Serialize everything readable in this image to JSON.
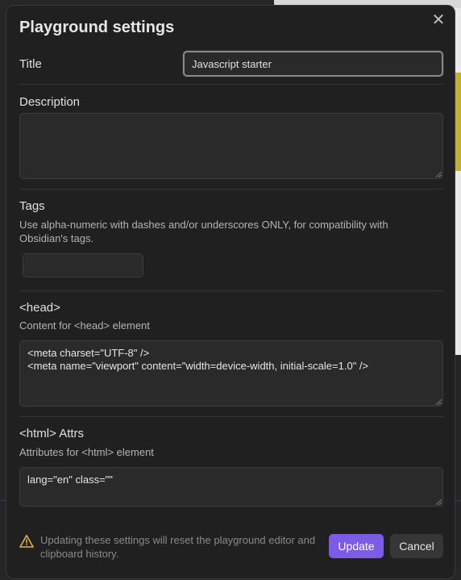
{
  "modal": {
    "title": "Playground settings",
    "close_glyph": "✕"
  },
  "fields": {
    "title": {
      "label": "Title",
      "value": "Javascript starter"
    },
    "description": {
      "label": "Description",
      "value": ""
    },
    "tags": {
      "label": "Tags",
      "help": "Use alpha-numeric with dashes and/or underscores ONLY, for compatibility with Obsidian's tags.",
      "value": ""
    },
    "head": {
      "label": "<head>",
      "help": "Content for <head> element",
      "value": "<meta charset=\"UTF-8\" />\n<meta name=\"viewport\" content=\"width=device-width, initial-scale=1.0\" />"
    },
    "html_attrs": {
      "label": "<html> Attrs",
      "help": "Attributes for <html> element",
      "value": "lang=\"en\" class=\"\""
    }
  },
  "footer": {
    "warning_icon": "warning-triangle-icon",
    "warning_text": "Updating these settings will reset the playground editor and clipboard history.",
    "update_label": "Update",
    "cancel_label": "Cancel"
  },
  "colors": {
    "accent": "#7c5ce6",
    "warning": "#e0b43a"
  }
}
